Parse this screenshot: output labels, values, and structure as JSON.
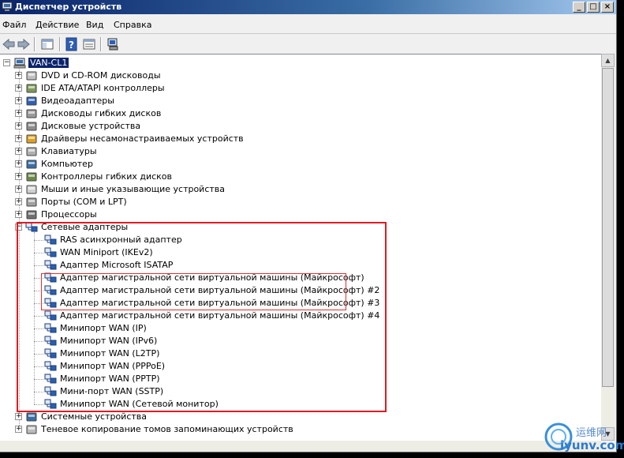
{
  "window": {
    "title": "Диспетчер устройств"
  },
  "menu": [
    "Файл",
    "Действие",
    "Вид",
    "Справка"
  ],
  "tree": {
    "root": "VAN-CL1",
    "categories": [
      {
        "label": "DVD и CD-ROM дисководы",
        "icon": "dvd-drive-icon"
      },
      {
        "label": "IDE ATA/ATAPI контроллеры",
        "icon": "ide-controller-icon"
      },
      {
        "label": "Видеоадаптеры",
        "icon": "display-adapter-icon"
      },
      {
        "label": "Дисководы гибких дисков",
        "icon": "floppy-drive-icon"
      },
      {
        "label": "Дисковые устройства",
        "icon": "disk-drive-icon"
      },
      {
        "label": "Драйверы несамонастраиваемых устройств",
        "icon": "driver-gear-icon"
      },
      {
        "label": "Клавиатуры",
        "icon": "keyboard-icon"
      },
      {
        "label": "Компьютер",
        "icon": "computer-icon"
      },
      {
        "label": "Контроллеры гибких дисков",
        "icon": "floppy-controller-icon"
      },
      {
        "label": "Мыши и иные указывающие устройства",
        "icon": "mouse-icon"
      },
      {
        "label": "Порты (COM и LPT)",
        "icon": "port-icon"
      },
      {
        "label": "Процессоры",
        "icon": "processor-icon"
      }
    ],
    "network": {
      "label": "Сетевые адаптеры",
      "items": [
        "RAS асинхронный адаптер",
        "WAN Miniport (IKEv2)",
        "Адаптер Microsoft ISATAP",
        "Адаптер магистральной сети виртуальной машины (Майкрософт)",
        "Адаптер магистральной сети виртуальной машины (Майкрософт) #2",
        "Адаптер магистральной сети виртуальной машины (Майкрософт) #3",
        "Адаптер магистральной сети виртуальной машины (Майкрософт) #4",
        "Минипорт WAN (IP)",
        "Минипорт WAN (IPv6)",
        "Минипорт WAN (L2TP)",
        "Минипорт WAN (PPPoE)",
        "Минипорт WAN (PPTP)",
        "Мини-порт WAN (SSTP)",
        "Минипорт WAN (Сетевой монитор)"
      ]
    },
    "after": [
      {
        "label": "Системные устройства",
        "icon": "system-devices-icon"
      },
      {
        "label": "Теневое копирование томов запоминающих устройств",
        "icon": "volume-shadow-icon"
      }
    ]
  },
  "watermark": {
    "line1": "运维网",
    "line2": "iyunv.com"
  },
  "colors": {
    "highlight": "#e01b24",
    "selection": "#0a246a"
  }
}
